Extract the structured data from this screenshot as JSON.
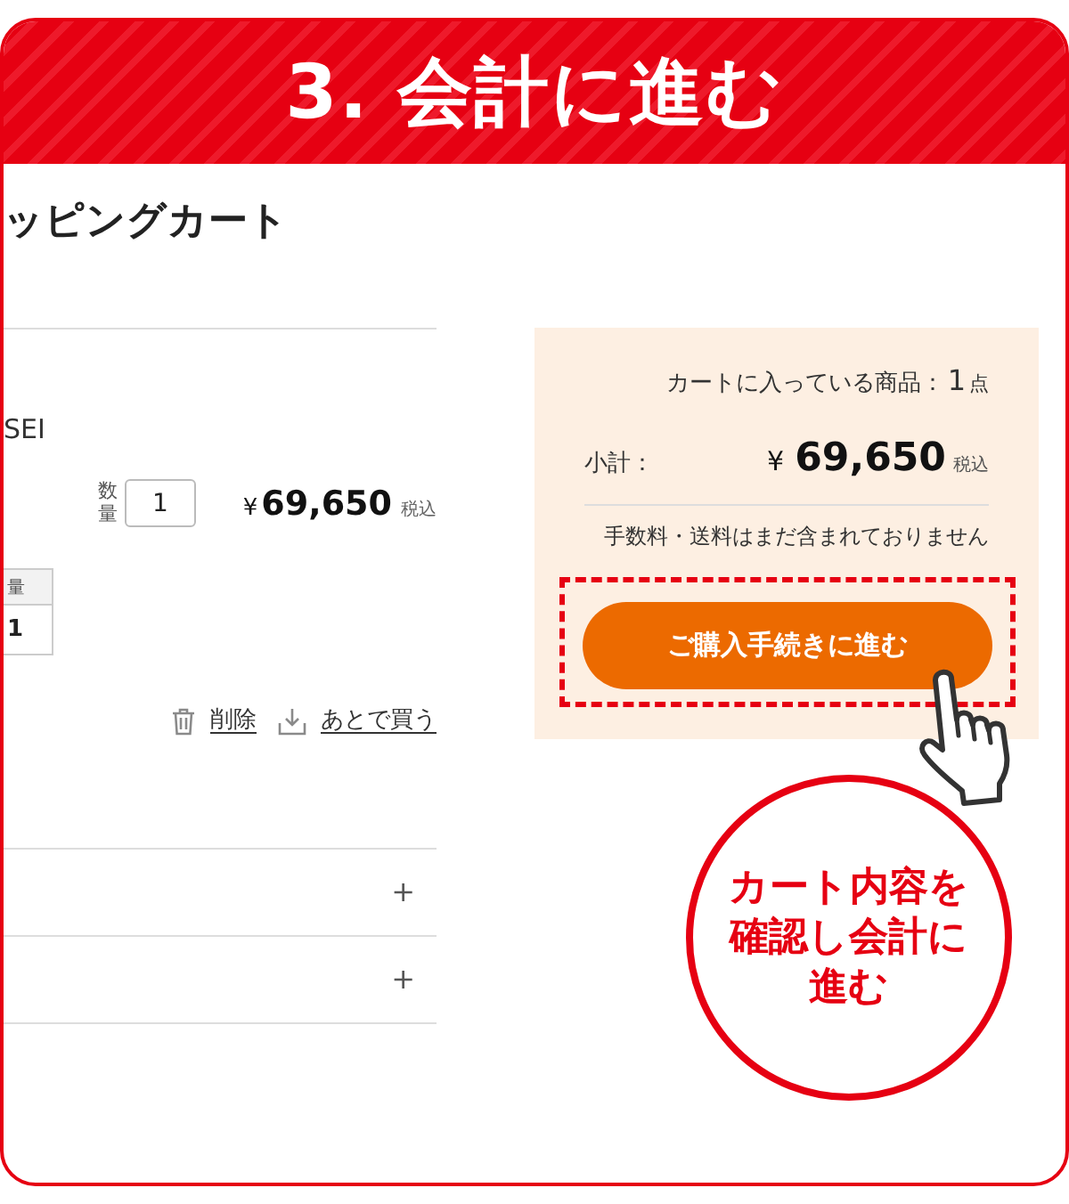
{
  "banner": {
    "title": "3. 会計に進む"
  },
  "cart": {
    "heading": "ッピングカート",
    "item": {
      "name": "SEI",
      "quantity_label": "数量",
      "quantity": "1",
      "currency": "¥",
      "price": "69,650",
      "tax_note": "税込",
      "table": {
        "columns": [
          "量"
        ],
        "rows": [
          [
            "1"
          ]
        ]
      }
    },
    "actions": [
      {
        "kind": "delete",
        "label": "削除"
      },
      {
        "kind": "save_for_later",
        "label": "あとで買う"
      }
    ],
    "sections": [
      {
        "toggle": "+"
      },
      {
        "toggle": "+"
      }
    ]
  },
  "summary": {
    "count_label": "カートに入っている商品：",
    "count": "1",
    "count_unit": "点",
    "subtotal_label": "小計：",
    "currency": "¥",
    "subtotal": "69,650",
    "tax_note": "税込",
    "fee_note": "手数料・送料はまだ含まれておりません",
    "checkout_button": "ご購入手続きに進む"
  },
  "callout": {
    "text": "カート内容を確認し会計に進む"
  }
}
